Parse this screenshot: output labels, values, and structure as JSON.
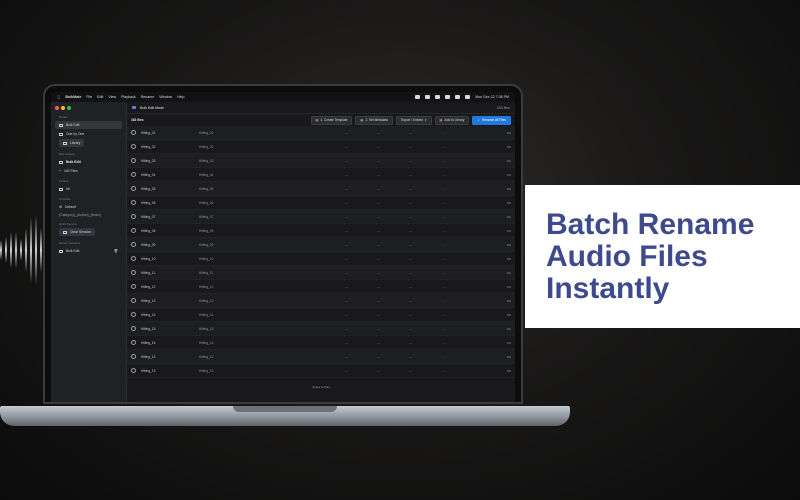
{
  "promo": {
    "line1": "Batch Rename",
    "line2": "Audio Files",
    "line3": "Instantly"
  },
  "menubar": {
    "app": "BulkMate",
    "items": [
      "File",
      "Edit",
      "View",
      "Playback",
      "Rename",
      "Window",
      "Help"
    ],
    "clock": "Mon Dec 22  7:08 PM"
  },
  "sidebar": {
    "sections": {
      "modes": "Modes",
      "bulk_session": "Bulk Session",
      "folders": "Folders",
      "template": "Template",
      "quick_session": "Quick Session",
      "recent": "Recent Sessions"
    },
    "modes": [
      "Bulk Edit",
      "One by One",
      "Library"
    ],
    "session_items": [
      "Bulk Edit",
      "163 Files"
    ],
    "folders": [
      "hit"
    ],
    "template_name": "Default",
    "template_pattern": "{Category}_{Action}_{Index}",
    "quick_session_btn": "Clear Session",
    "recent_item": "Bulk Edit"
  },
  "main": {
    "title": "Bulk Edit Mode",
    "count_right": "163 files",
    "count_left": "163 files",
    "toolbar": {
      "create_template": "1. Create Template",
      "set_metadata": "2. Set Metadata",
      "export": "Export / Embed",
      "add_library": "Add to Library",
      "rename_all": "Rename All Files"
    },
    "placeholder_dash": "—",
    "row_more": "•••",
    "hint": "Space to Play",
    "rows": [
      {
        "name": "Hitting_01",
        "new": "Hitting_01"
      },
      {
        "name": "Hitting_02",
        "new": "Hitting_02"
      },
      {
        "name": "Hitting_03",
        "new": "Hitting_03"
      },
      {
        "name": "Hitting_04",
        "new": "Hitting_04"
      },
      {
        "name": "Hitting_05",
        "new": "Hitting_05"
      },
      {
        "name": "Hitting_06",
        "new": "Hitting_06"
      },
      {
        "name": "Hitting_07",
        "new": "Hitting_07"
      },
      {
        "name": "Hitting_08",
        "new": "Hitting_08"
      },
      {
        "name": "Hitting_09",
        "new": "Hitting_09"
      },
      {
        "name": "Hitting_10",
        "new": "Hitting_10"
      },
      {
        "name": "Hitting_11",
        "new": "Hitting_11"
      },
      {
        "name": "Hitting_12",
        "new": "Hitting_12"
      },
      {
        "name": "Hitting_13",
        "new": "Hitting_13"
      },
      {
        "name": "Hitting_14",
        "new": "Hitting_14"
      },
      {
        "name": "Hitting_15",
        "new": "Hitting_15"
      },
      {
        "name": "Hitting_16",
        "new": "Hitting_16"
      },
      {
        "name": "Hitting_12",
        "new": "Hitting_12"
      },
      {
        "name": "Hitting_13",
        "new": "Hitting_13"
      }
    ]
  },
  "colors": {
    "accent": "#1f7ae0",
    "promo_text": "#3d4a8c"
  }
}
